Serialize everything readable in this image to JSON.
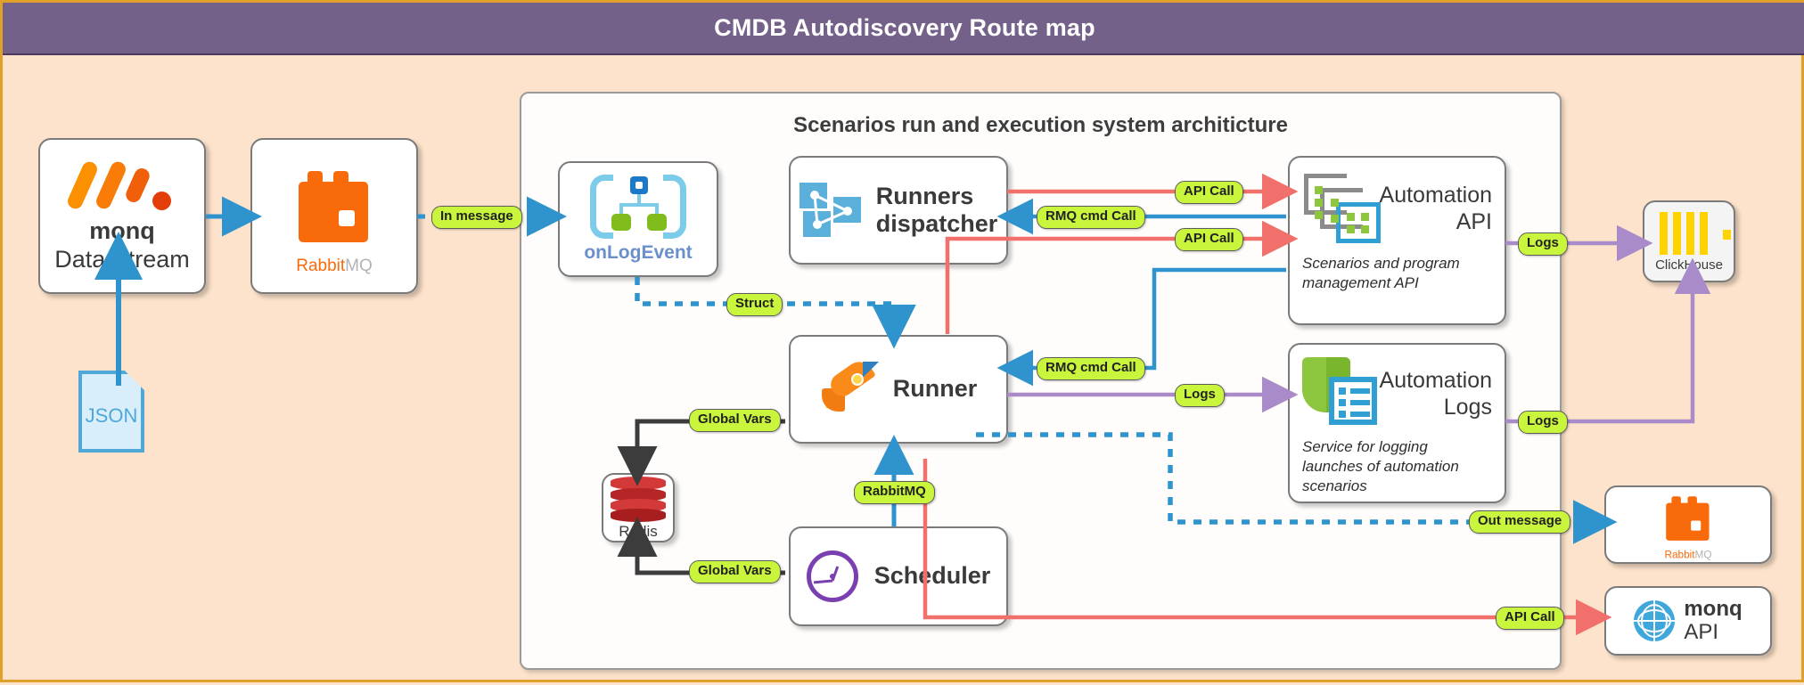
{
  "header": {
    "title": "CMDB Autodiscovery Route map"
  },
  "container": {
    "title": "Scenarios run and execution system architicture"
  },
  "nodes": {
    "monq_data_stream": {
      "title": "monq",
      "subtitle": "Data Stream",
      "icon": "monq-logo-icon"
    },
    "rabbitmq_in": {
      "title_a": "Rabbit",
      "title_b": "MQ",
      "icon": "rabbitmq-icon"
    },
    "json": {
      "label": "JSON",
      "icon": "json-document-icon"
    },
    "onlogevent": {
      "label": "onLogEvent",
      "icon": "onlogevent-icon"
    },
    "runners_dispatcher": {
      "label": "Runners\ndispatcher",
      "line1": "Runners",
      "line2": "dispatcher",
      "icon": "runners-dispatcher-icon"
    },
    "runner": {
      "label": "Runner",
      "icon": "rocket-icon"
    },
    "redis": {
      "label": "Redis",
      "icon": "redis-icon"
    },
    "scheduler": {
      "label": "Scheduler",
      "icon": "clock-icon"
    },
    "automation_api": {
      "line1": "Automation",
      "line2": "API",
      "description": "Scenarios and program management API",
      "icon": "automation-api-icon"
    },
    "automation_logs": {
      "line1": "Automation",
      "line2": "Logs",
      "description": "Service for logging launches of automation scenarios",
      "icon": "automation-logs-icon"
    },
    "clickhouse": {
      "label": "ClickHouse",
      "icon": "clickhouse-icon"
    },
    "rabbitmq_out": {
      "title_a": "Rabbit",
      "title_b": "MQ",
      "icon": "rabbitmq-icon"
    },
    "monq_api": {
      "title": "monq",
      "subtitle": "API",
      "icon": "monq-globe-icon"
    }
  },
  "edge_labels": {
    "in_message": "In message",
    "struct": "Struct",
    "api_call_1": "API Call",
    "rmq_cmd_1": "RMQ cmd Call",
    "api_call_2": "API Call",
    "rmq_cmd_2": "RMQ cmd Call",
    "logs_api": "Logs",
    "logs_runner": "Logs",
    "logs_logs": "Logs",
    "global_vars_1": "Global Vars",
    "global_vars_2": "Global Vars",
    "rabbitmq_edge": "RabbitMQ",
    "out_message": "Out message",
    "api_call_3": "API Call"
  },
  "colors": {
    "header_bg": "#74618a",
    "canvas_bg": "#fde3cb",
    "canvas_border": "#e0a12a",
    "pill_bg": "#c9f53c",
    "blue_wire": "#2f93cd",
    "red_wire": "#f2706b",
    "purple_wire": "#a98bc9",
    "dark_wire": "#3c3c3c",
    "dotted_wire": "#2f93cd",
    "orange": "#f96a0b"
  }
}
